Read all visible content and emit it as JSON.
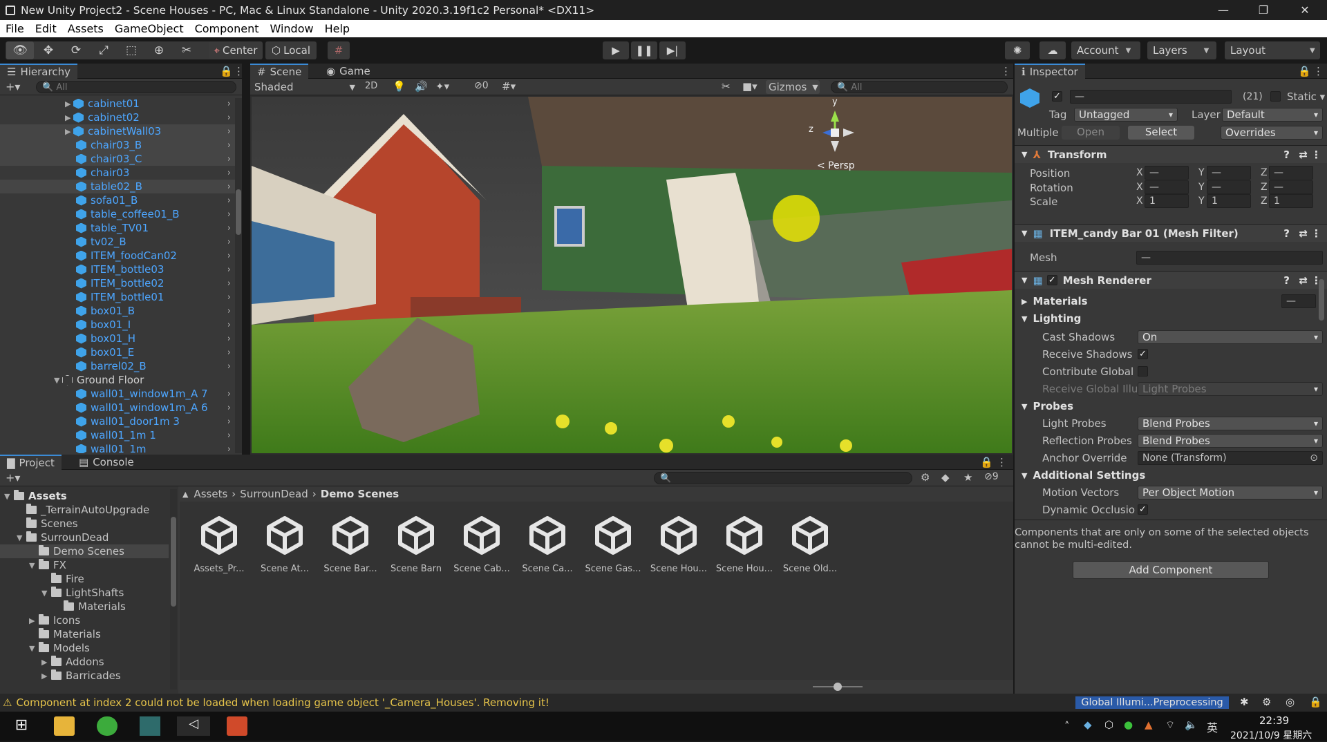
{
  "window": {
    "title": "New Unity Project2 - Scene Houses - PC, Mac & Linux Standalone - Unity 2020.3.19f1c2 Personal* <DX11>"
  },
  "menu": [
    "File",
    "Edit",
    "Assets",
    "GameObject",
    "Component",
    "Window",
    "Help"
  ],
  "toolbar": {
    "pivot": "Center",
    "space": "Local",
    "account": "Account",
    "layers": "Layers",
    "layout": "Layout"
  },
  "hierarchy": {
    "tab": "Hierarchy",
    "search_placeholder": "All",
    "items": [
      {
        "label": "cabinet01",
        "fold": "▶"
      },
      {
        "label": "cabinet02",
        "fold": "▶"
      },
      {
        "label": "cabinetWall03",
        "fold": "▶"
      },
      {
        "label": "chair03_B",
        "fold": ""
      },
      {
        "label": "chair03_C",
        "fold": ""
      },
      {
        "label": "chair03",
        "fold": ""
      },
      {
        "label": "table02_B",
        "fold": ""
      },
      {
        "label": "sofa01_B",
        "fold": ""
      },
      {
        "label": "table_coffee01_B",
        "fold": ""
      },
      {
        "label": "table_TV01",
        "fold": ""
      },
      {
        "label": "tv02_B",
        "fold": ""
      },
      {
        "label": "ITEM_foodCan02",
        "fold": ""
      },
      {
        "label": "ITEM_bottle03",
        "fold": ""
      },
      {
        "label": "ITEM_bottle02",
        "fold": ""
      },
      {
        "label": "ITEM_bottle01",
        "fold": ""
      },
      {
        "label": "box01_B",
        "fold": ""
      },
      {
        "label": "box01_I",
        "fold": ""
      },
      {
        "label": "box01_H",
        "fold": ""
      },
      {
        "label": "box01_E",
        "fold": ""
      },
      {
        "label": "barrel02_B",
        "fold": ""
      },
      {
        "label": "Ground Floor",
        "fold": "▼"
      },
      {
        "label": "wall01_window1m_A 7",
        "fold": ""
      },
      {
        "label": "wall01_window1m_A 6",
        "fold": ""
      },
      {
        "label": "wall01_door1m 3",
        "fold": ""
      },
      {
        "label": "wall01_1m 1",
        "fold": ""
      },
      {
        "label": "wall01_1m",
        "fold": ""
      }
    ]
  },
  "scene": {
    "tabs": [
      "Scene",
      "Game"
    ],
    "shading": "Shaded",
    "mode2d": "2D",
    "hidden_count": "0",
    "gizmos": "Gizmos",
    "search_placeholder": "All",
    "persp": "< Persp",
    "axis_y": "y",
    "axis_z": "z"
  },
  "inspector": {
    "tab": "Inspector",
    "object_name": "—",
    "count": "(21)",
    "static": "Static",
    "tag_label": "Tag",
    "tag": "Untagged",
    "layer_label": "Layer",
    "layer": "Default",
    "multiple": "Multiple",
    "open": "Open",
    "select": "Select",
    "overrides": "Overrides",
    "transform": {
      "title": "Transform",
      "rows": [
        {
          "label": "Position",
          "x": "—",
          "y": "—",
          "z": "—"
        },
        {
          "label": "Rotation",
          "x": "—",
          "y": "—",
          "z": "—"
        },
        {
          "label": "Scale",
          "x": "1",
          "y": "1",
          "z": "1"
        }
      ],
      "axes": [
        "X",
        "Y",
        "Z"
      ]
    },
    "meshfilter": {
      "title": "ITEM_candy Bar 01 (Mesh Filter)",
      "mesh_label": "Mesh",
      "mesh_value": "—"
    },
    "meshrenderer": {
      "title": "Mesh Renderer",
      "materials": "Materials",
      "lighting": "Lighting",
      "cast_shadows_label": "Cast Shadows",
      "cast_shadows": "On",
      "receive_shadows_label": "Receive Shadows",
      "contribute_gi_label": "Contribute Global I",
      "receive_gi_label": "Receive Global Illu",
      "receive_gi": "Light Probes",
      "probes": "Probes",
      "light_probes_label": "Light Probes",
      "light_probes": "Blend Probes",
      "reflection_probes_label": "Reflection Probes",
      "reflection_probes": "Blend Probes",
      "anchor_label": "Anchor Override",
      "anchor": "None (Transform)",
      "additional": "Additional Settings",
      "motion_label": "Motion Vectors",
      "motion": "Per Object Motion",
      "dynamic_label": "Dynamic Occlusio"
    },
    "note": "Components that are only on some of the selected objects cannot be multi-edited.",
    "add_component": "Add Component"
  },
  "project": {
    "tabs": [
      "Project",
      "Console"
    ],
    "hidden_count": "9",
    "breadcrumb": [
      "Assets",
      "SurrounDead",
      "Demo Scenes"
    ],
    "tree": [
      {
        "label": "Assets",
        "indent": 0,
        "fold": "▼",
        "bold": true
      },
      {
        "label": "_TerrainAutoUpgrade",
        "indent": 1,
        "fold": ""
      },
      {
        "label": "Scenes",
        "indent": 1,
        "fold": ""
      },
      {
        "label": "SurrounDead",
        "indent": 1,
        "fold": "▼"
      },
      {
        "label": "Demo Scenes",
        "indent": 2,
        "fold": "",
        "selected": true
      },
      {
        "label": "FX",
        "indent": 2,
        "fold": "▼"
      },
      {
        "label": "Fire",
        "indent": 3,
        "fold": ""
      },
      {
        "label": "LightShafts",
        "indent": 3,
        "fold": "▼"
      },
      {
        "label": "Materials",
        "indent": 4,
        "fold": ""
      },
      {
        "label": "Icons",
        "indent": 2,
        "fold": "▶"
      },
      {
        "label": "Materials",
        "indent": 2,
        "fold": ""
      },
      {
        "label": "Models",
        "indent": 2,
        "fold": "▼"
      },
      {
        "label": "Addons",
        "indent": 3,
        "fold": "▶"
      },
      {
        "label": "Barricades",
        "indent": 3,
        "fold": "▶"
      }
    ],
    "assets": [
      "Assets_Pr...",
      "Scene At...",
      "Scene Bar...",
      "Scene Barn",
      "Scene Cab...",
      "Scene Ca...",
      "Scene Gas...",
      "Scene Hou...",
      "Scene Hou...",
      "Scene Old..."
    ]
  },
  "status": {
    "message": "Component at index 2 could not be loaded when loading game object '_Camera_Houses'. Removing it!",
    "progress": "Global Illumi...Preprocessing"
  },
  "taskbar": {
    "time": "22:39",
    "date": "2021/10/9 星期六",
    "ime": "英"
  }
}
